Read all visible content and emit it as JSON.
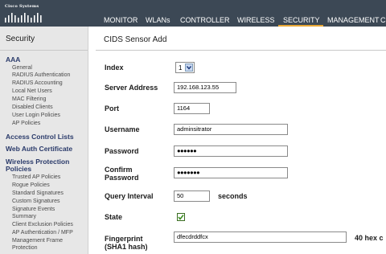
{
  "header": {
    "logo_text": "Cisco Systems",
    "nav": [
      "MONITOR",
      "WLANs",
      "CONTROLLER",
      "WIRELESS",
      "SECURITY",
      "MANAGEMENT",
      "C"
    ],
    "active_nav": "SECURITY"
  },
  "sidebar": {
    "title": "Security",
    "sections": [
      {
        "label": "AAA",
        "items": [
          "General",
          "RADIUS Authentication",
          "RADIUS Accounting",
          "Local Net Users",
          "MAC Filtering",
          "Disabled Clients",
          "User Login Policies",
          "AP Policies"
        ]
      },
      {
        "label": "Access Control Lists",
        "items": []
      },
      {
        "label": "Web Auth Certificate",
        "items": []
      },
      {
        "label": "Wireless Protection",
        "label2": "Policies",
        "items": [
          "Trusted AP Policies",
          "Rogue Policies",
          "Standard Signatures",
          "Custom Signatures",
          "Signature Events",
          "Summary",
          "Client Exclusion Policies",
          "AP Authentication / MFP",
          "Management Frame",
          "Protection"
        ]
      }
    ]
  },
  "main": {
    "page_title": "CIDS Sensor Add",
    "fields": {
      "index": {
        "label": "Index",
        "value": "1"
      },
      "server_address": {
        "label": "Server Address",
        "value": "192.168.123.55"
      },
      "port": {
        "label": "Port",
        "value": "1164"
      },
      "username": {
        "label": "Username",
        "value": "adminsitrator"
      },
      "password": {
        "label": "Password",
        "value": "●●●●●●"
      },
      "confirm_password": {
        "label": "Confirm",
        "label2": "Password",
        "value": "●●●●●●●"
      },
      "query_interval": {
        "label": "Query Interval",
        "value": "50",
        "unit": "seconds"
      },
      "state": {
        "label": "State",
        "checked": true
      },
      "fingerprint": {
        "label": "Fingerprint",
        "label2": "(SHA1 hash)",
        "value": "dfecdrddfcx",
        "hint": "40 hex c"
      }
    }
  },
  "colors": {
    "header_bg": "#3c4855",
    "active_underline": "#e8a634",
    "sidebar_bg": "#e7e7e7",
    "section_text": "#2a3a6a",
    "checkbox_check": "#3b8e1f"
  }
}
